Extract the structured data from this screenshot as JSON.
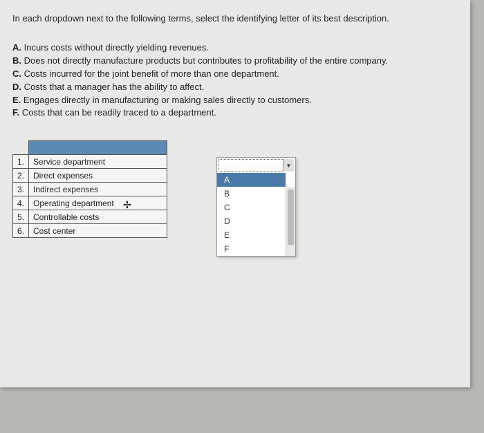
{
  "instruction": "In each dropdown next to the following terms, select the identifying letter of its best description.",
  "descriptions": [
    {
      "letter": "A.",
      "text": " Incurs costs without directly yielding revenues."
    },
    {
      "letter": "B.",
      "text": " Does not directly manufacture products but contributes to profitability of the entire company."
    },
    {
      "letter": "C.",
      "text": " Costs incurred for the joint benefit of more than one department."
    },
    {
      "letter": "D.",
      "text": " Costs that a manager has the ability to affect."
    },
    {
      "letter": "E.",
      "text": " Engages directly in manufacturing or making sales directly to customers."
    },
    {
      "letter": "F.",
      "text": " Costs that can be readily traced to a department."
    }
  ],
  "table": {
    "rows": [
      {
        "num": "1.",
        "term": "Service department"
      },
      {
        "num": "2.",
        "term": "Direct expenses"
      },
      {
        "num": "3.",
        "term": "Indirect expenses"
      },
      {
        "num": "4.",
        "term": "Operating department"
      },
      {
        "num": "5.",
        "term": "Controllable costs"
      },
      {
        "num": "6.",
        "term": "Cost center"
      }
    ]
  },
  "dropdown": {
    "options": [
      "A",
      "B",
      "C",
      "D",
      "E",
      "F"
    ],
    "selected": "A"
  }
}
